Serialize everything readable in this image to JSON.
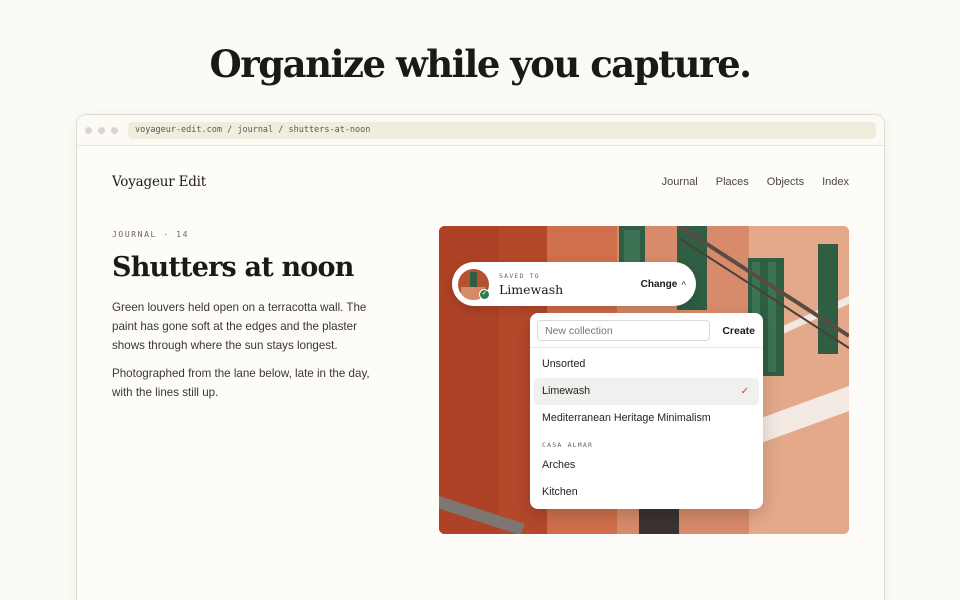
{
  "headline": "Organize while you capture.",
  "browser": {
    "url": "voyageur-edit.com / journal / shutters-at-noon"
  },
  "site": {
    "brand": "Voyageur Edit",
    "nav": [
      "Journal",
      "Places",
      "Objects",
      "Index"
    ]
  },
  "article": {
    "kicker": "JOURNAL · 14",
    "title": "Shutters at noon",
    "paragraphs": [
      "Green louvers held open on a terracotta wall. The paint has gone soft at the edges and the plaster shows through where the sun stays longest.",
      "Photographed from the lane below, late in the day, with the lines still up."
    ]
  },
  "save_pill": {
    "label": "SAVED TO",
    "collection": "Limewash",
    "change": "Change"
  },
  "dropdown": {
    "new_placeholder": "New collection",
    "create_label": "Create",
    "items": [
      "Unsorted",
      "Limewash",
      "Mediterranean Heritage Minimalism"
    ],
    "selected": "Limewash",
    "group_label": "CASA ALMAR",
    "group_items": [
      "Arches",
      "Kitchen"
    ]
  },
  "colors": {
    "accent_check": "#c0404a",
    "saved_badge": "#2f7a4e",
    "terracotta": "#c65a34",
    "shutter_green": "#2f5e43"
  },
  "icons": {
    "saved_badge": "check-icon",
    "change": "chevron-up-icon",
    "selected": "check-icon"
  }
}
